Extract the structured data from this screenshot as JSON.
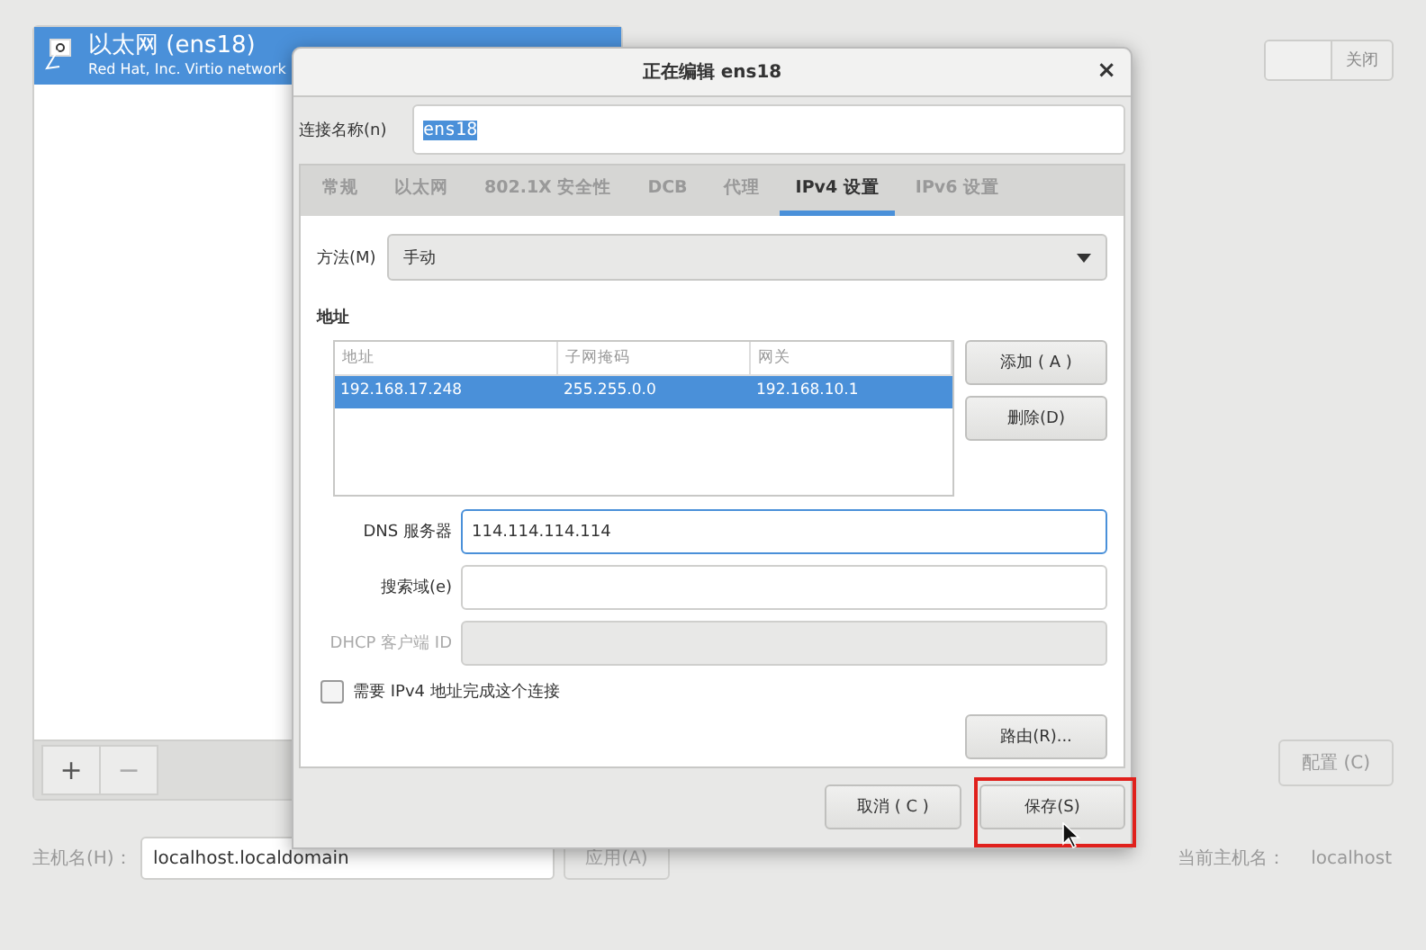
{
  "background": {
    "connections": [
      {
        "name": "以太网 (ens18)",
        "description": "Red Hat, Inc. Virtio network",
        "selected": true
      }
    ],
    "list_buttons": [
      "+",
      "−"
    ],
    "switch": {
      "label": "关闭",
      "on": false
    },
    "configure_button": "配置 (C)",
    "hostname": {
      "label": "主机名(H)：",
      "value": "localhost.localdomain",
      "apply_button": "应用(A)"
    },
    "current_hostname": {
      "label": "当前主机名：",
      "value": "localhost"
    }
  },
  "dialog": {
    "title": "正在编辑 ens18",
    "close": "×",
    "connection_name": {
      "label": "连接名称(n)",
      "value": "ens18",
      "text_selected": true
    },
    "tabs": [
      {
        "label": "常规",
        "selected": false
      },
      {
        "label": "以太网",
        "selected": false
      },
      {
        "label": "802.1X 安全性",
        "selected": false
      },
      {
        "label": "DCB",
        "selected": false
      },
      {
        "label": "代理",
        "selected": false
      },
      {
        "label": "IPv4 设置",
        "selected": true
      },
      {
        "label": "IPv6 设置",
        "selected": false
      }
    ],
    "method": {
      "label": "方法(M)",
      "value": "手动"
    },
    "addresses": {
      "title": "地址",
      "columns": [
        "地址",
        "子网掩码",
        "网关"
      ],
      "rows": [
        {
          "cells": [
            "192.168.17.248",
            "255.255.0.0",
            "192.168.10.1"
          ],
          "selected": true
        }
      ],
      "buttons": [
        "添加 ( A )",
        "删除(D)"
      ]
    },
    "fields": [
      {
        "label": "DNS 服务器",
        "value": "114.114.114.114",
        "focused": true,
        "disabled": false
      },
      {
        "label": "搜索域(e)",
        "focused": false,
        "disabled": false
      },
      {
        "label": "DHCP 客户端 ID",
        "focused": false,
        "disabled": true
      }
    ],
    "require_ipv4": {
      "label": "需要 IPv4 地址完成这个连接",
      "checked": false
    },
    "routes_button": "路由(R)...",
    "footer_buttons": [
      {
        "label": "取消 ( C )",
        "highlighted": false
      },
      {
        "label": "保存(S)",
        "highlighted": true
      }
    ]
  }
}
